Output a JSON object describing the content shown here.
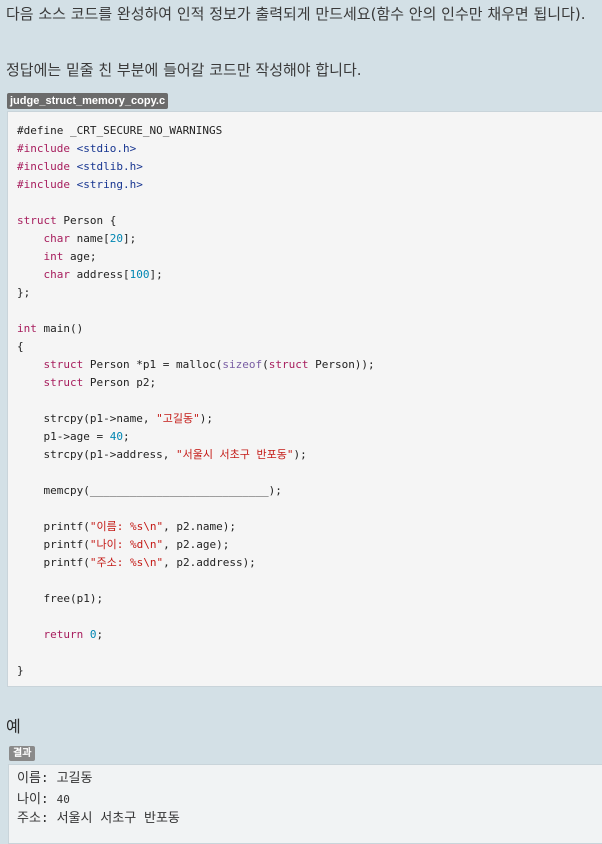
{
  "instructions": {
    "line1": "다음 소스 코드를 완성하여 인적 정보가 출력되게 만드세요(함수 안의 인수만 채우면 됩니다).",
    "line2": "정답에는 밑줄 친 부분에 들어갈 코드만 작성해야 합니다."
  },
  "code": {
    "filename": "judge_struct_memory_copy.c",
    "lines": {
      "l01_define": "#define _CRT_SECURE_NO_WARNINGS",
      "l02_kw": "#include",
      "l02_hdr": "<stdio.h>",
      "l03_kw": "#include",
      "l03_hdr": "<stdlib.h>",
      "l04_kw": "#include",
      "l04_hdr": "<string.h>",
      "l06_kw": "struct",
      "l06_rest": " Person {",
      "l07_kw": "char",
      "l07_a": " name[",
      "l07_n": "20",
      "l07_b": "];",
      "l08_kw": "int",
      "l08_rest": " age;",
      "l09_kw": "char",
      "l09_a": " address[",
      "l09_n": "100",
      "l09_b": "];",
      "l10": "};",
      "l12_kw": "int",
      "l12_rest": " main()",
      "l13": "{",
      "l14_kw": "struct",
      "l14_a": " Person *p1 = malloc(",
      "l14_fn": "sizeof",
      "l14_b": "(",
      "l14_kw2": "struct",
      "l14_c": " Person));",
      "l15_kw": "struct",
      "l15_rest": " Person p2;",
      "l17_a": "strcpy(p1->name, ",
      "l17_s": "\"고길동\"",
      "l17_b": ");",
      "l18_a": "p1->age = ",
      "l18_n": "40",
      "l18_b": ";",
      "l19_a": "strcpy(p1->address, ",
      "l19_s": "\"서울시 서초구 반포동\"",
      "l19_b": ");",
      "l21": "memcpy(___________________________);",
      "l23_a": "printf(",
      "l23_s": "\"이름: %s\\n\"",
      "l23_b": ", p2.name);",
      "l24_a": "printf(",
      "l24_s": "\"나이: %d\\n\"",
      "l24_b": ", p2.age);",
      "l25_a": "printf(",
      "l25_s": "\"주소: %s\\n\"",
      "l25_b": ", p2.address);",
      "l27": "free(p1);",
      "l29_kw": "return",
      "l29_sp": " ",
      "l29_n": "0",
      "l29_b": ";",
      "l31": "}"
    }
  },
  "example": {
    "heading": "예",
    "result_label": "결과",
    "name_label": "이름: ",
    "name_value": "고길동",
    "age_label": "나이: ",
    "age_value": "40",
    "address_label": "주소: ",
    "address_value": "서울시 서초구 반포동"
  }
}
